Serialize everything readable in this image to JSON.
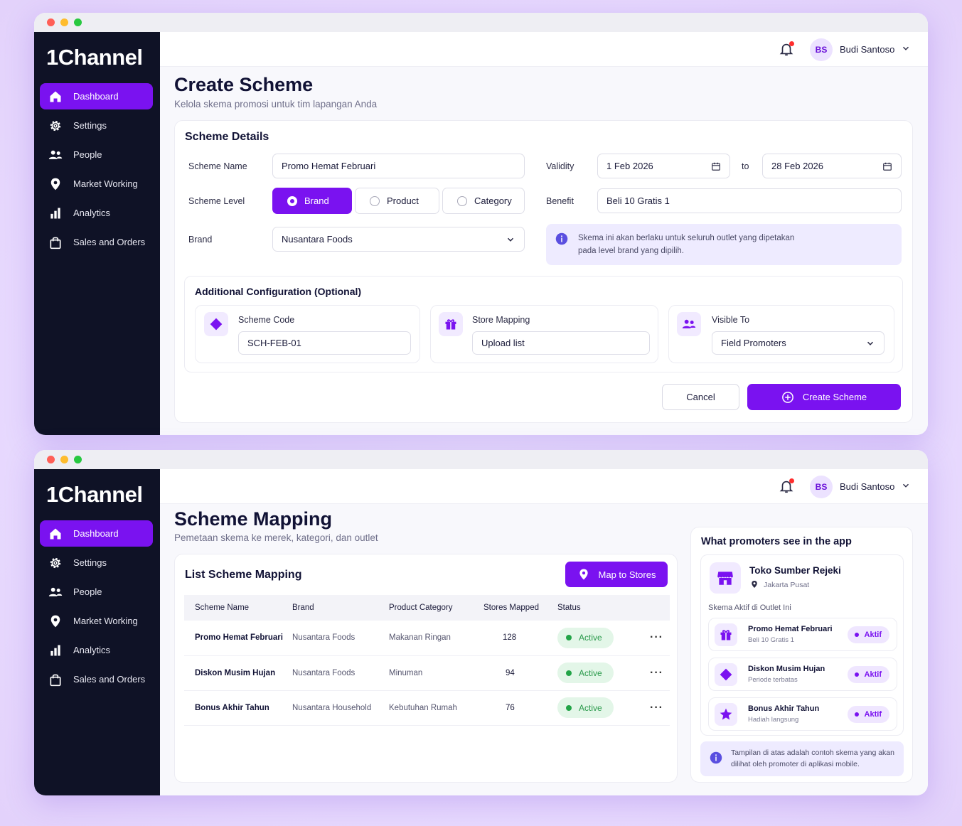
{
  "app": {
    "logo": "1Channel"
  },
  "nav": [
    {
      "label": "Dashboard",
      "icon": "home-icon"
    },
    {
      "label": "Settings",
      "icon": "gear-icon"
    },
    {
      "label": "People",
      "icon": "people-icon"
    },
    {
      "label": "Market Working",
      "icon": "location-pin-icon"
    },
    {
      "label": "Analytics",
      "icon": "bar-chart-icon"
    },
    {
      "label": "Sales and Orders",
      "icon": "shopping-bag-icon"
    }
  ],
  "user": {
    "initials": "BS",
    "name": "Budi Santoso"
  },
  "create": {
    "title": "Create Scheme",
    "subtitle": "Kelola skema promosi untuk tim lapangan Anda",
    "details_title": "Scheme Details",
    "scheme_name_label": "Scheme Name",
    "scheme_name_value": "Promo Hemat Februari",
    "scheme_level_label": "Scheme Level",
    "levels": [
      "Brand",
      "Product",
      "Category"
    ],
    "brand_label": "Brand",
    "brand_value": "Nusantara Foods",
    "validity_label": "Validity",
    "validity_from": "1 Feb 2026",
    "to_label": "to",
    "validity_to": "28 Feb 2026",
    "benefit_label": "Benefit",
    "benefit_value": "Beli 10 Gratis 1",
    "info_line1": "Skema ini akan berlaku untuk seluruh outlet yang dipetakan",
    "info_line2": "pada level brand yang dipilih.",
    "additional_title": "Additional Configuration (Optional)",
    "scheme_code_label": "Scheme Code",
    "scheme_code_value": "SCH-FEB-01",
    "store_mapping_label": "Store Mapping",
    "store_mapping_value": "Upload list",
    "visible_to_label": "Visible To",
    "visible_to_value": "Field Promoters",
    "cancel": "Cancel",
    "create_button": "Create Scheme"
  },
  "mapping": {
    "title": "Scheme Mapping",
    "subtitle": "Pemetaan skema ke merek, kategori, dan outlet",
    "list_title": "List Scheme Mapping",
    "map_button": "Map to Stores",
    "columns": [
      "Scheme Name",
      "Brand",
      "Product Category",
      "Stores Mapped",
      "Status"
    ],
    "rows": [
      {
        "name": "Promo Hemat Februari",
        "brand": "Nusantara Foods",
        "category": "Makanan Ringan",
        "stores": "128",
        "status": "Active"
      },
      {
        "name": "Diskon Musim Hujan",
        "brand": "Nusantara Foods",
        "category": "Minuman",
        "stores": "94",
        "status": "Active"
      },
      {
        "name": "Bonus Akhir Tahun",
        "brand": "Nusantara Household",
        "category": "Kebutuhan Rumah",
        "stores": "76",
        "status": "Active"
      }
    ]
  },
  "promoter": {
    "title": "What promoters see in the app",
    "store_name": "Toko Sumber Rejeki",
    "store_location": "Jakarta Pusat",
    "active_label": "Skema Aktif di Outlet Ini",
    "items": [
      {
        "name": "Promo Hemat Februari",
        "sub": "Beli 10 Gratis 1",
        "badge": "Aktif",
        "icon": "gift-icon"
      },
      {
        "name": "Diskon Musim Hujan",
        "sub": "Periode terbatas",
        "badge": "Aktif",
        "icon": "diamond-icon"
      },
      {
        "name": "Bonus Akhir Tahun",
        "sub": "Hadiah langsung",
        "badge": "Aktif",
        "icon": "star-icon"
      }
    ],
    "note_line1": "Tampilan di atas adalah contoh skema yang akan",
    "note_line2": "dilihat oleh promoter di aplikasi mobile."
  },
  "colors": {
    "accent": "#7a12f0",
    "sidebar": "#0f1226",
    "active_green": "#22a447"
  }
}
